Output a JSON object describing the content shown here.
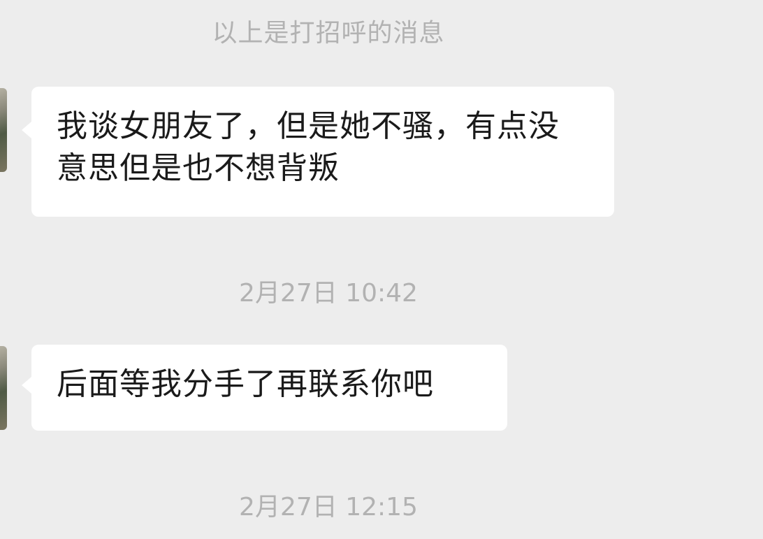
{
  "chat": {
    "greeting_note": "以上是打招呼的消息",
    "messages": [
      {
        "text": "我谈女朋友了，但是她不骚，有点没意思但是也不想背叛"
      },
      {
        "text": "后面等我分手了再联系你吧"
      }
    ],
    "timestamps": [
      "2月27日 10:42",
      "2月27日 12:15"
    ]
  }
}
